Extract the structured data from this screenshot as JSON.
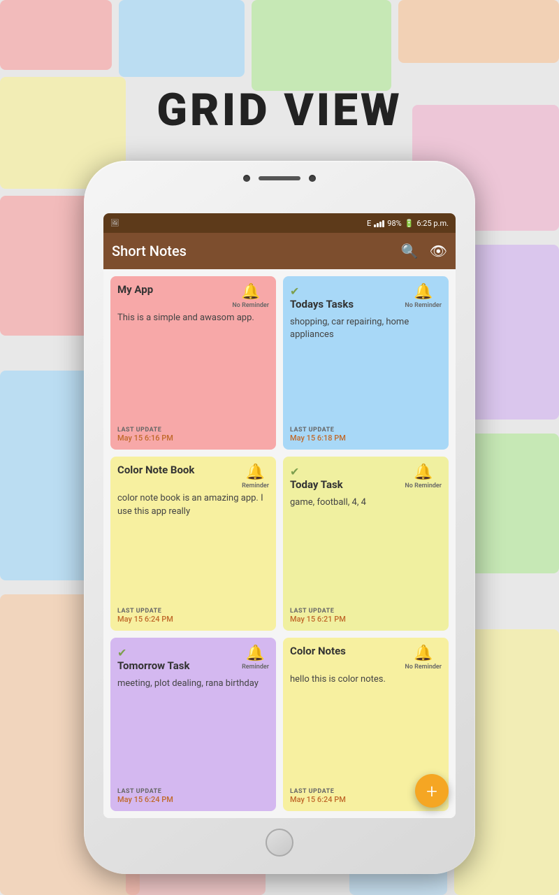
{
  "background": {
    "label": "GRID VIEW"
  },
  "status_bar": {
    "signal": "E",
    "signal_bars": 4,
    "battery": "98%",
    "time": "6:25 p.m."
  },
  "toolbar": {
    "title": "Short Notes",
    "search_icon": "🔍",
    "eye_icon": "👁"
  },
  "notes": [
    {
      "id": "note-1",
      "color": "pink",
      "has_check": false,
      "title": "My App",
      "body": "This is a simple and awasom app.",
      "reminder": "No Reminder",
      "reminder_active": false,
      "last_update_label": "LAST UPDATE",
      "last_update": "May 15 6:16 PM"
    },
    {
      "id": "note-2",
      "color": "blue",
      "has_check": true,
      "title": "Todays Tasks",
      "body": "shopping, car repairing, home appliances",
      "reminder": "No Reminder",
      "reminder_active": false,
      "last_update_label": "LAST UPDATE",
      "last_update": "May 15 6:18 PM"
    },
    {
      "id": "note-3",
      "color": "yellow",
      "has_check": false,
      "title": "Color Note Book",
      "body": "color note book is an amazing app. I use this app really",
      "reminder": "Reminder",
      "reminder_active": true,
      "last_update_label": "LAST UPDATE",
      "last_update": "May 15 6:24 PM"
    },
    {
      "id": "note-4",
      "color": "yellow2",
      "has_check": true,
      "title": "Today Task",
      "body": "game, football, 4, 4",
      "reminder": "No Reminder",
      "reminder_active": false,
      "last_update_label": "LAST UPDATE",
      "last_update": "May 15 6:21 PM"
    },
    {
      "id": "note-5",
      "color": "purple",
      "has_check": true,
      "title": "Tomorrow Task",
      "body": "meeting, plot dealing, rana birthday",
      "reminder": "Reminder",
      "reminder_active": true,
      "last_update_label": "LAST UPDATE",
      "last_update": "May 15 6:24 PM"
    },
    {
      "id": "note-6",
      "color": "yellow",
      "has_check": false,
      "title": "Color Notes",
      "body": "hello this is color notes.",
      "reminder": "No Reminder",
      "reminder_active": false,
      "last_update_label": "LAST UPDATE",
      "last_update": "May 15 6:24 PM"
    }
  ],
  "fab": {
    "label": "+"
  }
}
